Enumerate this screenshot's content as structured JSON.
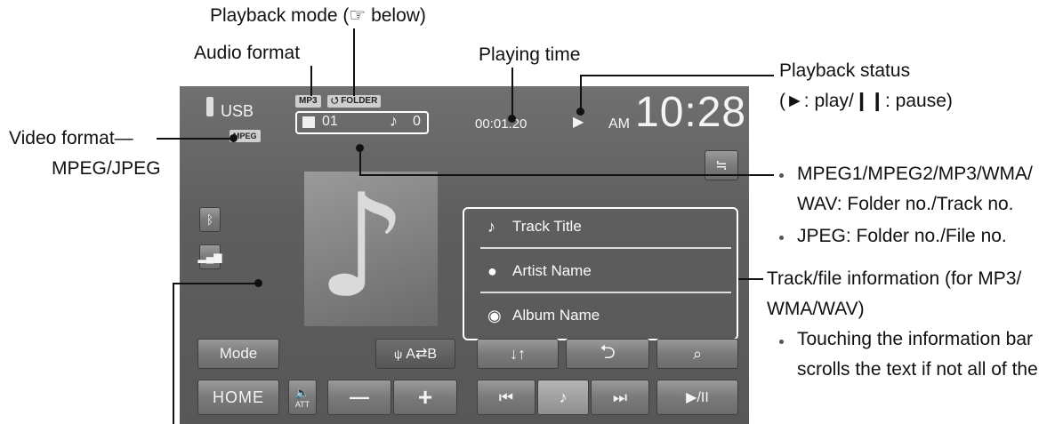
{
  "annotations": {
    "playback_mode": "Playback mode (☞ below)",
    "audio_format": "Audio format",
    "playing_time": "Playing time",
    "playback_status_1": "Playback status",
    "playback_status_2": "(►: play/❙❙: pause)",
    "video_format_1": "Video format—",
    "video_format_2": "MPEG/JPEG",
    "folder_track_1a": "MPEG1/MPEG2/MP3/WMA/",
    "folder_track_1b": "WAV: Folder no./Track no.",
    "folder_track_2": "JPEG: Folder no./File no.",
    "track_info_1": "Track/file information (for MP3/",
    "track_info_2": "WMA/WAV)",
    "scroll_note_1": "Touching the information bar",
    "scroll_note_2": "scrolls the text if not all of the"
  },
  "screen": {
    "source": "USB",
    "audio_badge": "MP3",
    "mode_badge": "FOLDER",
    "video_badge": "MPEG",
    "folder_no": "01",
    "track_no": "0",
    "playing_time": "00:01:20",
    "ampm": "AM",
    "clock": "10:28",
    "track_title": "Track Title",
    "artist_name": "Artist Name",
    "album_name": "Album Name",
    "buttons": {
      "mode": "Mode",
      "ab_repeat": "A⇄B",
      "home": "HOME",
      "att": "ATT",
      "vol_down": "—",
      "vol_up": "+",
      "play_pause": "▶/II"
    }
  },
  "icons": [
    "usb-icon",
    "bluetooth-icon",
    "equalizer-icon",
    "music-note-icon",
    "folder-icon",
    "person-icon",
    "disc-icon",
    "random-icon",
    "repeat-icon",
    "search-icon",
    "prev-icon",
    "next-icon",
    "speaker-icon",
    "scroll-toggle-icon"
  ]
}
